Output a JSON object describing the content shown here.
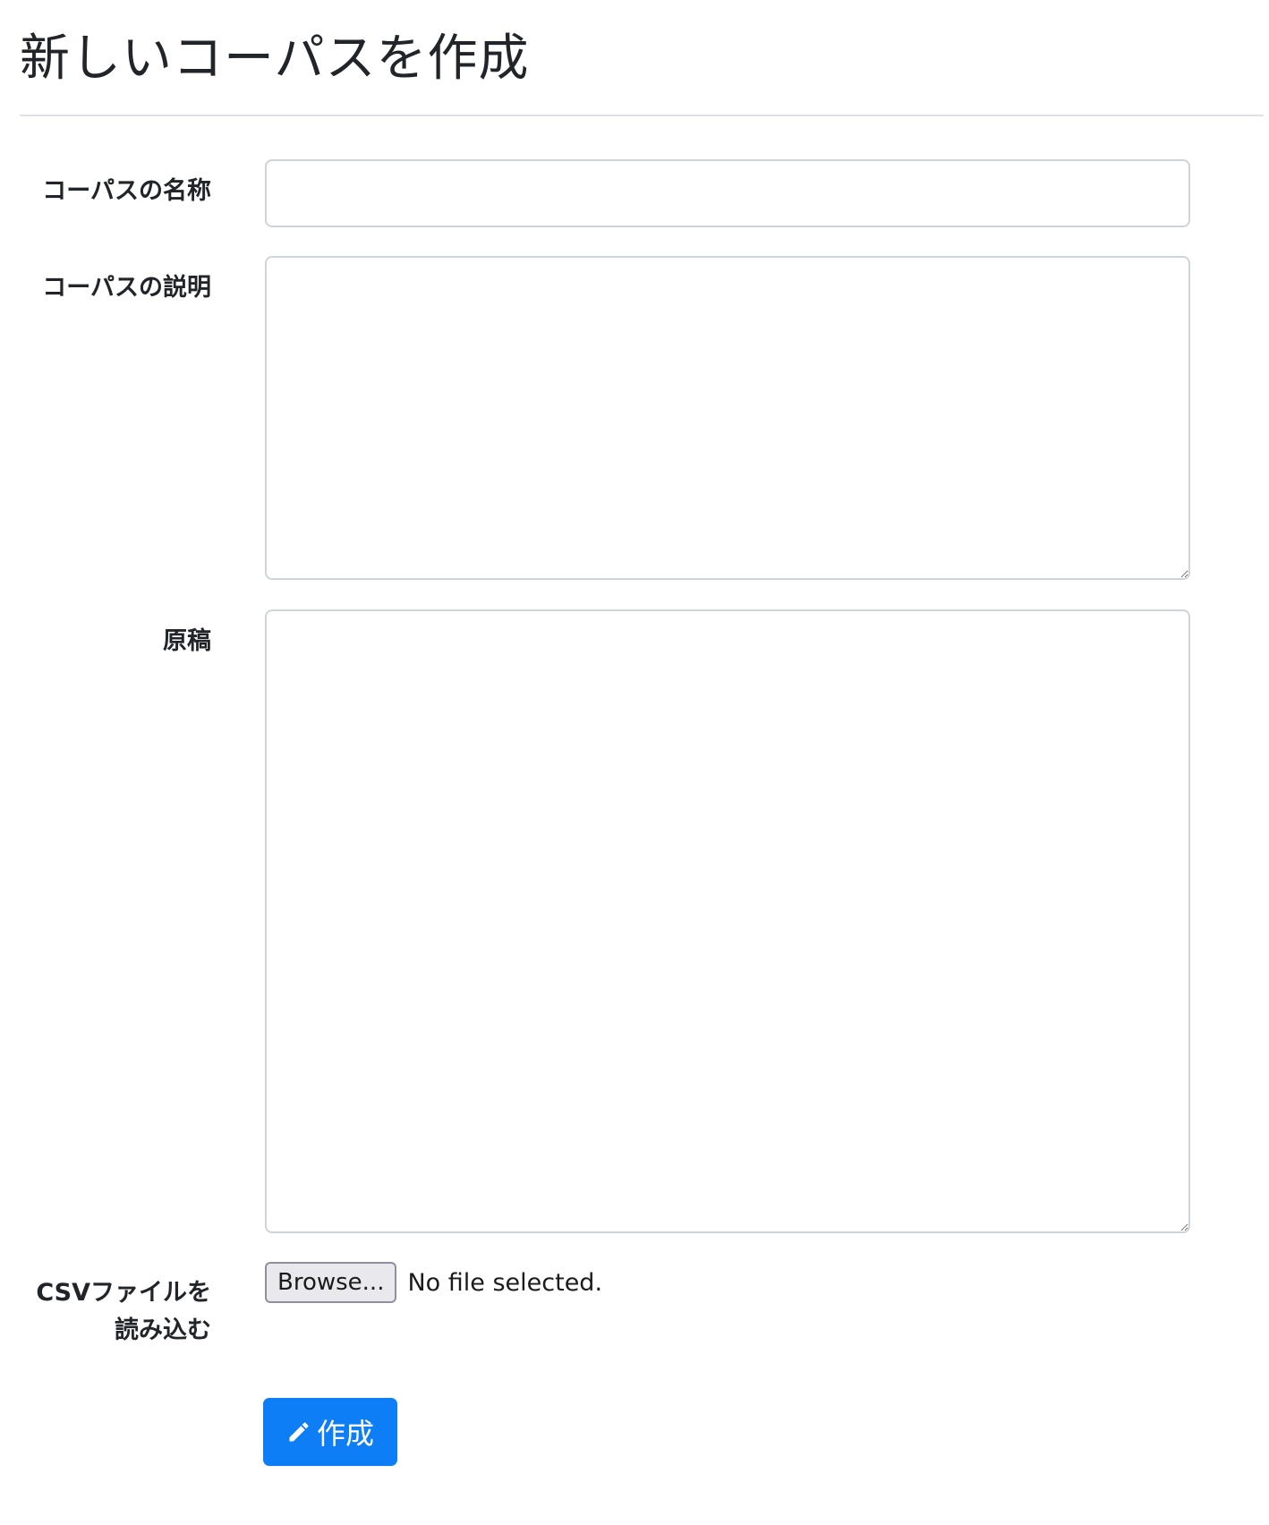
{
  "page": {
    "title": "新しいコーパスを作成"
  },
  "form": {
    "name_label": "コーパスの名称",
    "name_value": "",
    "description_label": "コーパスの説明",
    "description_value": "",
    "manuscript_label": "原稿",
    "manuscript_value": "",
    "csv_label_line1": "CSVファイルを",
    "csv_label_line2": "読み込む",
    "browse_label": "Browse...",
    "file_status": "No file selected.",
    "submit_label": "作成",
    "submit_icon": "pencil-icon"
  },
  "colors": {
    "primary": "#0d7ef6",
    "border": "#ced4da",
    "text": "#212529"
  }
}
